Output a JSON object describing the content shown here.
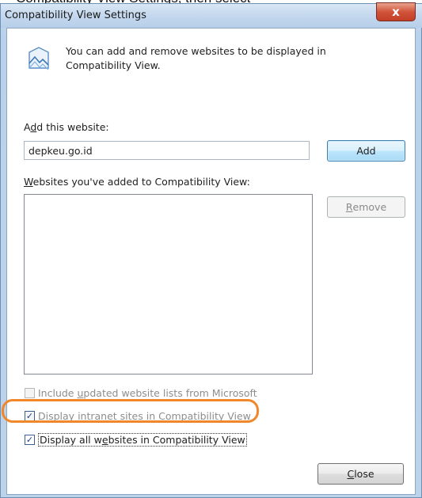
{
  "top_crop_text": "Compatibility View Settings, then select",
  "window": {
    "title": "Compatibility View Settings",
    "close_glyph": "x",
    "icon": "compatibility-view-icon"
  },
  "info": {
    "line1": "You can add and remove websites to be displayed in",
    "line2": "Compatibility View."
  },
  "add_website": {
    "label_prefix": "A",
    "label_accel": "d",
    "label_rest": "d this website:",
    "value": "depkeu.go.id",
    "add_button": "Add"
  },
  "sites_list": {
    "label_accel": "W",
    "label_rest": "ebsites you've added to Compatibility View:",
    "items": [],
    "remove_prefix": "",
    "remove_accel": "R",
    "remove_rest": "emove"
  },
  "options": [
    {
      "pre": "Include ",
      "accel": "u",
      "post": "pdated website lists from Microsoft",
      "checked": false,
      "enabled": false
    },
    {
      "pre": "Display ",
      "accel": "i",
      "post": "ntranet sites in Compatibility View",
      "checked": true,
      "enabled": false
    },
    {
      "pre": "Display all w",
      "accel": "e",
      "post": "bsites in Compatibility View",
      "checked": true,
      "enabled": true
    }
  ],
  "close_button": {
    "accel": "C",
    "rest": "lose"
  },
  "colors": {
    "highlight": "#f0872a",
    "title_bg": "#c4d8ee",
    "close_red": "#c23f26"
  }
}
